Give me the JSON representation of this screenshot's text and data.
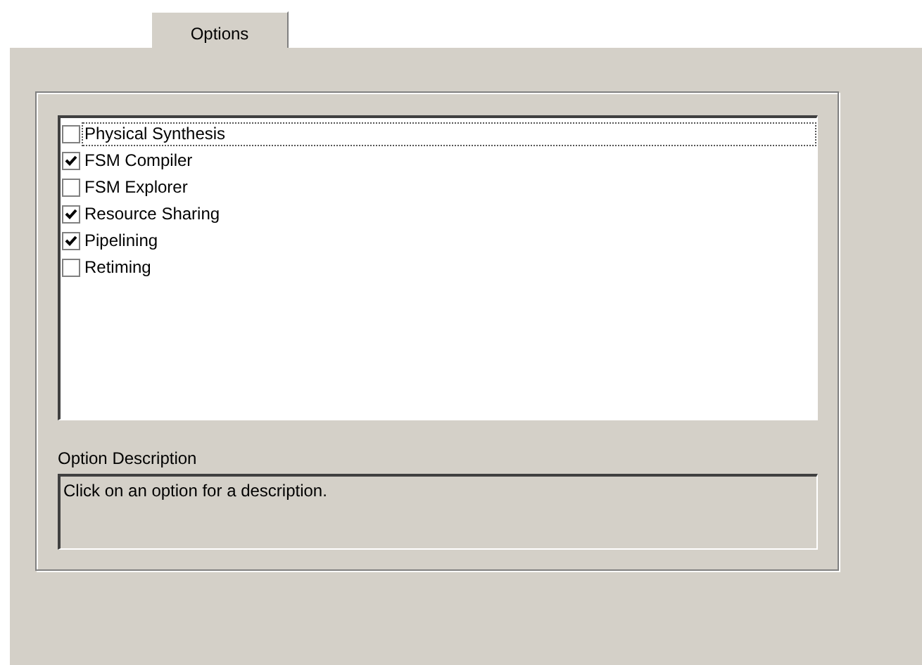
{
  "tabs": [
    {
      "label": "Options",
      "selected": true
    }
  ],
  "options": [
    {
      "label": "Physical Synthesis",
      "checked": false,
      "focused": true
    },
    {
      "label": "FSM Compiler",
      "checked": true,
      "focused": false
    },
    {
      "label": "FSM Explorer",
      "checked": false,
      "focused": false
    },
    {
      "label": "Resource Sharing",
      "checked": true,
      "focused": false
    },
    {
      "label": "Pipelining",
      "checked": true,
      "focused": false
    },
    {
      "label": "Retiming",
      "checked": false,
      "focused": false
    }
  ],
  "description": {
    "label": "Option Description",
    "text": "Click on an option for a description."
  }
}
